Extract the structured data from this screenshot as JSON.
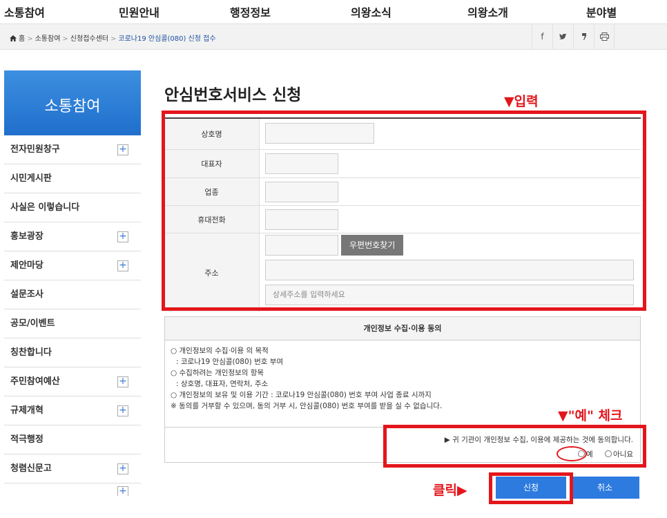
{
  "topnav": {
    "items": [
      "소통참여",
      "민원안내",
      "행정정보",
      "의왕소식",
      "의왕소개",
      "분야별"
    ]
  },
  "breadcrumb": {
    "home": "홈",
    "items": [
      "소통참여",
      "신청접수센터"
    ],
    "current": "코로나19 안심콜(080) 신청 접수"
  },
  "share": {
    "facebook": "f",
    "twitter": "t",
    "kakao": "k",
    "print": "print"
  },
  "sidebar": {
    "title": "소통참여",
    "items": [
      {
        "label": "전자민원창구",
        "expandable": true
      },
      {
        "label": "시민게시판",
        "expandable": false
      },
      {
        "label": "사실은 이렇습니다",
        "expandable": false
      },
      {
        "label": "홍보광장",
        "expandable": true
      },
      {
        "label": "제안마당",
        "expandable": true
      },
      {
        "label": "설문조사",
        "expandable": false
      },
      {
        "label": "공모/이벤트",
        "expandable": false
      },
      {
        "label": "칭찬합니다",
        "expandable": false
      },
      {
        "label": "주민참여예산",
        "expandable": true
      },
      {
        "label": "규제개혁",
        "expandable": true
      },
      {
        "label": "적극행정",
        "expandable": false
      },
      {
        "label": "청렴신문고",
        "expandable": true
      }
    ]
  },
  "page": {
    "title": "안심번호서비스 신청"
  },
  "form": {
    "business_name_label": "상호명",
    "representative_label": "대표자",
    "industry_label": "업종",
    "mobile_label": "휴대전화",
    "address_label": "주소",
    "zip_button": "우편번호찾기",
    "detail_address_placeholder": "상세주소를 입력하세요"
  },
  "consent": {
    "title": "개인정보 수집·이용 동의",
    "lines": [
      "○ 개인정보의 수집·이용 의 목적",
      ": 코로나19 안심콜(080) 번호 부여",
      "○ 수집하려는 개인정보의 항목",
      ": 상호명, 대표자, 연락처, 주소",
      "○ 개인정보의 보유 및 이용 기간 : 코로나19 안심콜(080) 번호 부여 사업 종료 시까지",
      "※ 동의를 거부할 수 있으며, 동의 거부 시, 안심콜(080) 번호 부여를 받을 실 수 없습니다."
    ],
    "agree_text": "▶ 귀 기관이 개인정보 수집, 이용에 제공하는 것에 동의합니다.",
    "yes_label": "예",
    "no_label": "아니요"
  },
  "buttons": {
    "apply": "신청",
    "cancel": "취소"
  },
  "annotations": {
    "input_label": "▼입력",
    "check_label": "▼\"예\" 체크",
    "click_label": "클릭▶",
    "color": "#e3161c"
  }
}
